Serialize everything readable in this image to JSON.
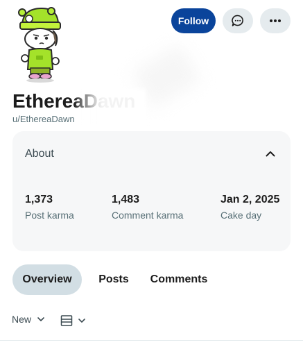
{
  "profile": {
    "display_name": "EthereaDawn",
    "handle": "u/EthereaDawn"
  },
  "actions": {
    "follow_label": "Follow"
  },
  "about": {
    "title": "About",
    "stats": [
      {
        "value": "1,373",
        "label": "Post karma"
      },
      {
        "value": "1,483",
        "label": "Comment karma"
      },
      {
        "value": "Jan 2, 2025",
        "label": "Cake day"
      }
    ]
  },
  "tabs": [
    {
      "label": "Overview",
      "active": true
    },
    {
      "label": "Posts",
      "active": false
    },
    {
      "label": "Comments",
      "active": false
    }
  ],
  "feed_controls": {
    "sort_label": "New"
  },
  "colors": {
    "accent": "#0a449b",
    "tab_active_bg": "#d2dee4",
    "card_bg": "#f6f7f8"
  }
}
